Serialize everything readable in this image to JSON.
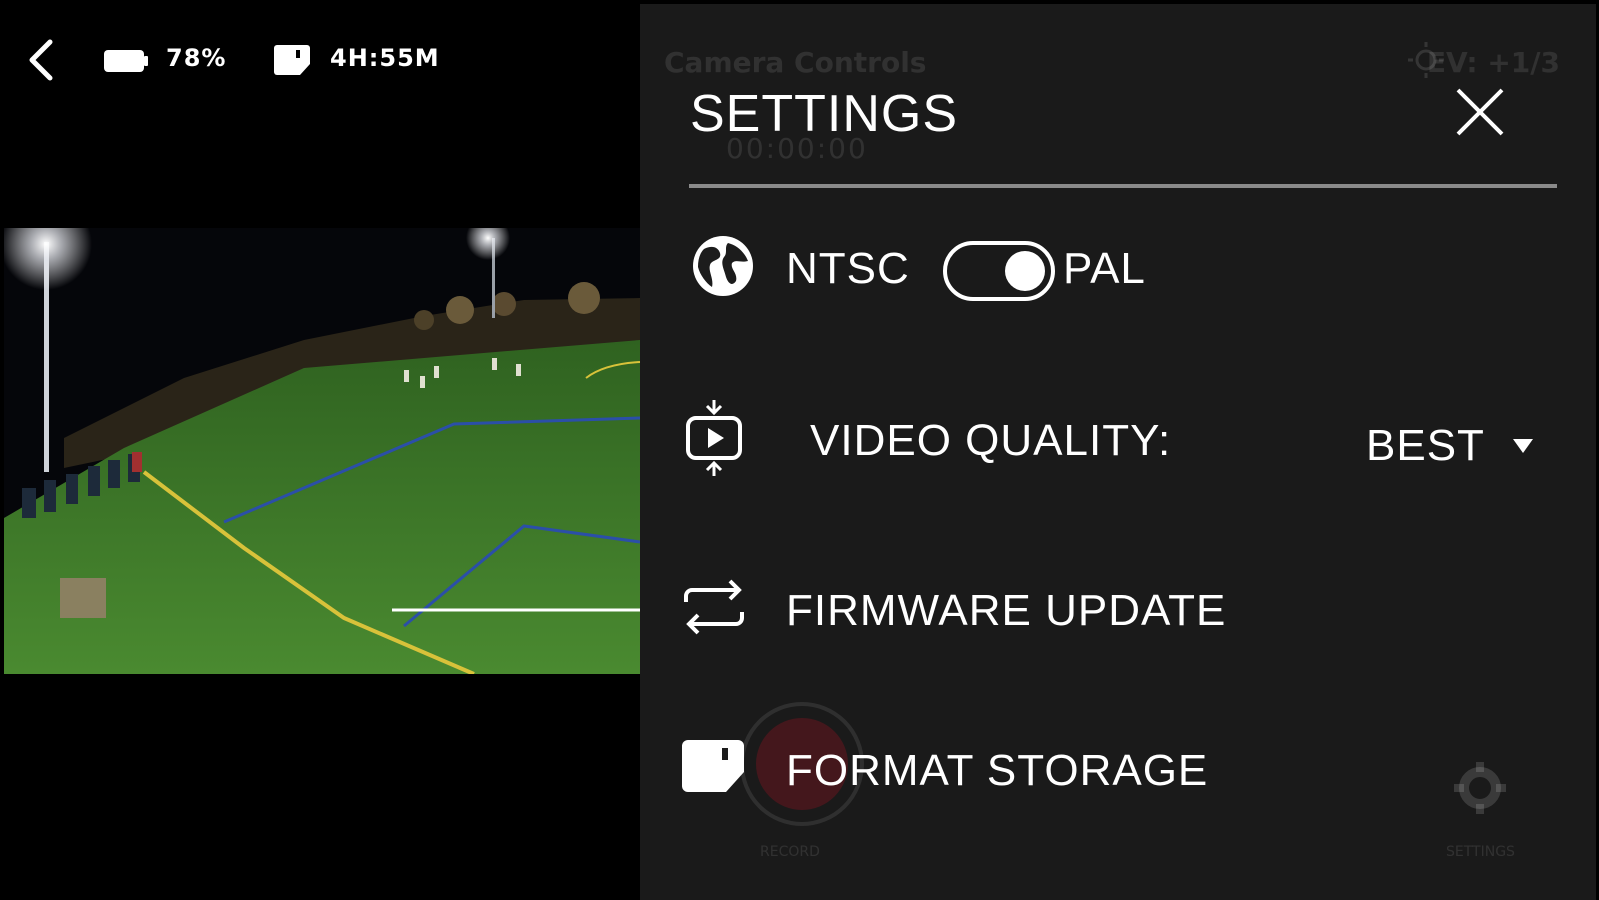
{
  "status_bar": {
    "battery_text": "78%",
    "recording_time_text": "4H:55M"
  },
  "background_hud": {
    "panel_title": "Camera Controls",
    "ev_text": "EV: +1/3",
    "timer_text": "00:00:00",
    "record_label": "RECORD",
    "settings_label": "SETTINGS"
  },
  "settings_panel": {
    "title": "SETTINGS",
    "video_standard": {
      "left_label": "NTSC",
      "right_label": "PAL",
      "selected": "PAL"
    },
    "video_quality": {
      "label": "VIDEO QUALITY:",
      "value": "BEST"
    },
    "firmware_update": {
      "label": "FIRMWARE UPDATE"
    },
    "format_storage": {
      "label": "FORMAT STORAGE"
    }
  },
  "colors": {
    "panel_bg": "#1c1c1c",
    "accent": "#ffffff",
    "record_red": "#78141e",
    "grass": "#3e7a2a",
    "field_line_yellow": "#d8c23a",
    "field_line_blue": "#2b4fa8"
  },
  "icons": {
    "back": "chevron-left-icon",
    "battery": "battery-icon",
    "storage": "sd-card-icon",
    "close": "close-icon",
    "globe": "globe-icon",
    "video_quality": "video-quality-icon",
    "firmware": "refresh-arrows-icon",
    "format": "sd-card-icon"
  }
}
